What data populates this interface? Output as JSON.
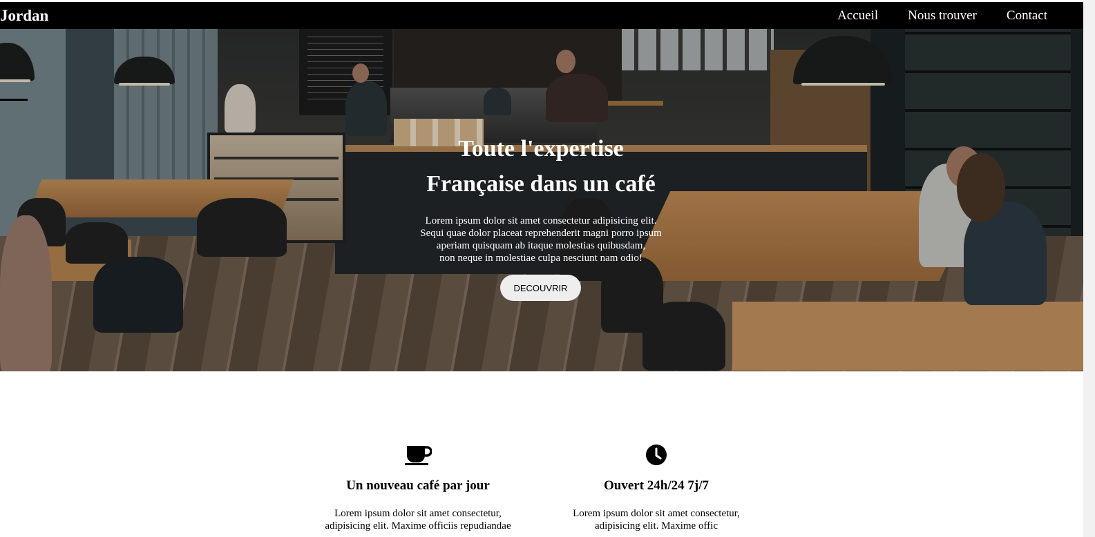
{
  "nav": {
    "brand": "Jordan",
    "items": [
      {
        "label": "Accueil"
      },
      {
        "label": "Nous trouver"
      },
      {
        "label": "Contact"
      }
    ]
  },
  "hero": {
    "title_line1": "Toute l'expertise",
    "title_line2": "Française dans un café",
    "text_line1": "Lorem ipsum dolor sit amet consectetur adipisicing elit.",
    "text_line2": "Sequi quae dolor placeat reprehenderit magni porro ipsum",
    "text_line3": "aperiam quisquam ab itaque molestias quibusdam,",
    "text_line4": "non neque in molestiae culpa nesciunt nam odio!",
    "button_label": "DECOUVRIR"
  },
  "features": [
    {
      "icon": "coffee-cup-icon",
      "title": "Un nouveau café par jour",
      "text_line1": "Lorem ipsum dolor sit amet consectetur,",
      "text_line2": "adipisicing elit. Maxime officiis repudiandae"
    },
    {
      "icon": "clock-icon",
      "title": "Ouvert 24h/24 7j/7",
      "text_line1": "Lorem ipsum dolor sit amet consectetur,",
      "text_line2": "adipisicing elit. Maxime offic"
    }
  ],
  "colors": {
    "nav_bg": "#000000",
    "nav_text": "#ffffff",
    "button_bg": "#eeeeee"
  }
}
